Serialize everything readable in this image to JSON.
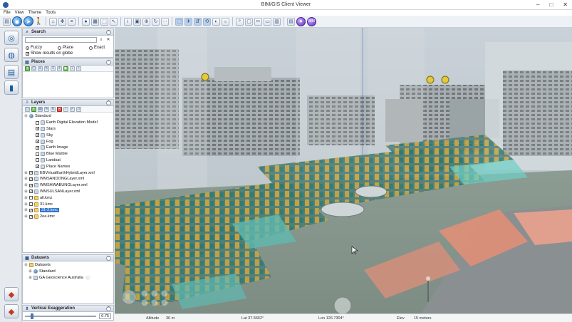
{
  "window": {
    "title": "BIM/GIS Client Viewer",
    "minimize": "–",
    "maximize": "□",
    "close": "✕"
  },
  "menu": [
    "File",
    "View",
    "Theme",
    "Tools"
  ],
  "search_panel": {
    "title": "Search",
    "placeholder": "",
    "modes": [
      {
        "label": "Fuzzy",
        "selected": true
      },
      {
        "label": "Place",
        "selected": false
      },
      {
        "label": "Exact",
        "selected": false
      }
    ],
    "show_on_globe_label": "Show results on globe",
    "show_on_globe_checked": true
  },
  "places_panel": {
    "title": "Places"
  },
  "layers_panel": {
    "title": "Layers",
    "items": [
      {
        "label": "Standard",
        "level": 0,
        "checked": null,
        "icon": "globe",
        "expanded": true
      },
      {
        "label": "Earth Digital Elevation Model",
        "level": 1,
        "checked": false,
        "icon": "layer"
      },
      {
        "label": "Stars",
        "level": 1,
        "checked": true,
        "icon": "layer"
      },
      {
        "label": "Sky",
        "level": 1,
        "checked": true,
        "icon": "layer"
      },
      {
        "label": "Fog",
        "level": 1,
        "checked": true,
        "icon": "layer"
      },
      {
        "label": "Earth Image",
        "level": 1,
        "checked": true,
        "icon": "layer"
      },
      {
        "label": "Blue Marble",
        "level": 1,
        "checked": false,
        "icon": "layer"
      },
      {
        "label": "Landsat",
        "level": 1,
        "checked": false,
        "icon": "layer"
      },
      {
        "label": "Place Names",
        "level": 1,
        "checked": true,
        "icon": "layer"
      },
      {
        "label": "EBVirtualEarthHybridLayer.xml",
        "level": 0,
        "checked": true,
        "icon": "layer"
      },
      {
        "label": "WMSANDONGLayer.xml",
        "level": 0,
        "checked": true,
        "icon": "layer"
      },
      {
        "label": "WMSHWABUNGLayer.xml",
        "level": 0,
        "checked": true,
        "icon": "layer"
      },
      {
        "label": "WMSULSANLayer.xml",
        "level": 0,
        "checked": true,
        "icon": "layer"
      },
      {
        "label": "all.kmz",
        "level": 0,
        "checked": false,
        "icon": "folder"
      },
      {
        "label": "31.kmc",
        "level": 0,
        "checked": false,
        "icon": "folder"
      },
      {
        "label": "31-2.kmc",
        "level": 0,
        "checked": true,
        "icon": "folder",
        "selected": true
      },
      {
        "label": "2ea.kmc",
        "level": 0,
        "checked": true,
        "icon": "folder"
      }
    ]
  },
  "datasets_panel": {
    "title": "Datasets",
    "items": [
      {
        "label": "Datasets",
        "level": 0
      },
      {
        "label": "Standard",
        "level": 1
      },
      {
        "label": "GA Geoscience Australia",
        "level": 1
      }
    ]
  },
  "vertical_exaggeration": {
    "title": "Vertical Exaggeration",
    "value": "0.75"
  },
  "status": {
    "altitude_label": "Altitude",
    "altitude_value": "36 m",
    "lat": "Lat 37.5662°",
    "lon": "Lon 126.7304°",
    "elev_label": "Elev",
    "elev_value": "15 meters"
  },
  "toolbar_icons": [
    "open-icon",
    "globe-icon",
    "navigate-icon",
    "walk-icon",
    "pan-icon",
    "zoom-icon",
    "measure-icon",
    "settings-icon",
    "info-icon",
    "grid-icon",
    "select-icon",
    "camera-icon"
  ],
  "colors": {
    "accent": "#1d6fc2",
    "selection": "#3276c9",
    "building_yellow": "#c8a23a",
    "building_teal": "#2e8b84"
  }
}
